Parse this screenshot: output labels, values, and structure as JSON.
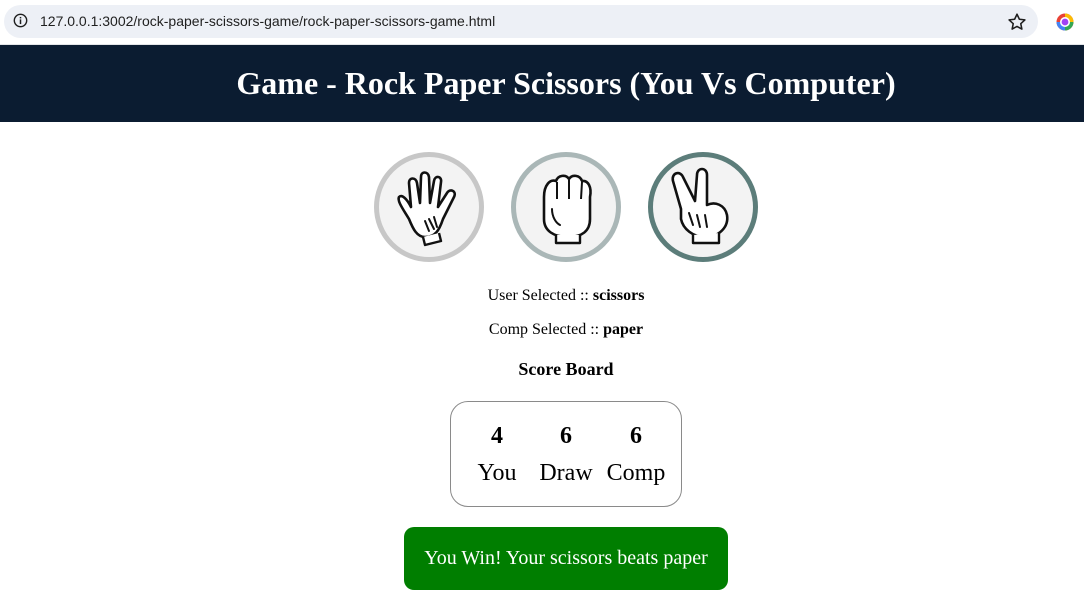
{
  "browser": {
    "url": "127.0.0.1:3002/rock-paper-scissors-game/rock-paper-scissors-game.html"
  },
  "header": {
    "title": "Game - Rock Paper Scissors (You Vs Computer)"
  },
  "choices": [
    {
      "id": "paper",
      "icon": "open-hand-icon"
    },
    {
      "id": "rock",
      "icon": "fist-icon"
    },
    {
      "id": "scissors",
      "icon": "peace-sign-hand-icon"
    }
  ],
  "selection": {
    "user_label": "User Selected ::",
    "user_value": "scissors",
    "comp_label": "Comp Selected ::",
    "comp_value": "paper"
  },
  "scoreboard": {
    "title": "Score Board",
    "you_score": "4",
    "you_label": "You",
    "draw_score": "6",
    "draw_label": "Draw",
    "comp_score": "6",
    "comp_label": "Comp"
  },
  "result": {
    "message": "You Win! Your scissors beats paper",
    "color": "#007e00"
  },
  "colors": {
    "header_bg": "#0b1c31",
    "paper_border": "#c7c7c7",
    "rock_border": "#aab7b7",
    "scissors_border": "#5c7d7a"
  }
}
